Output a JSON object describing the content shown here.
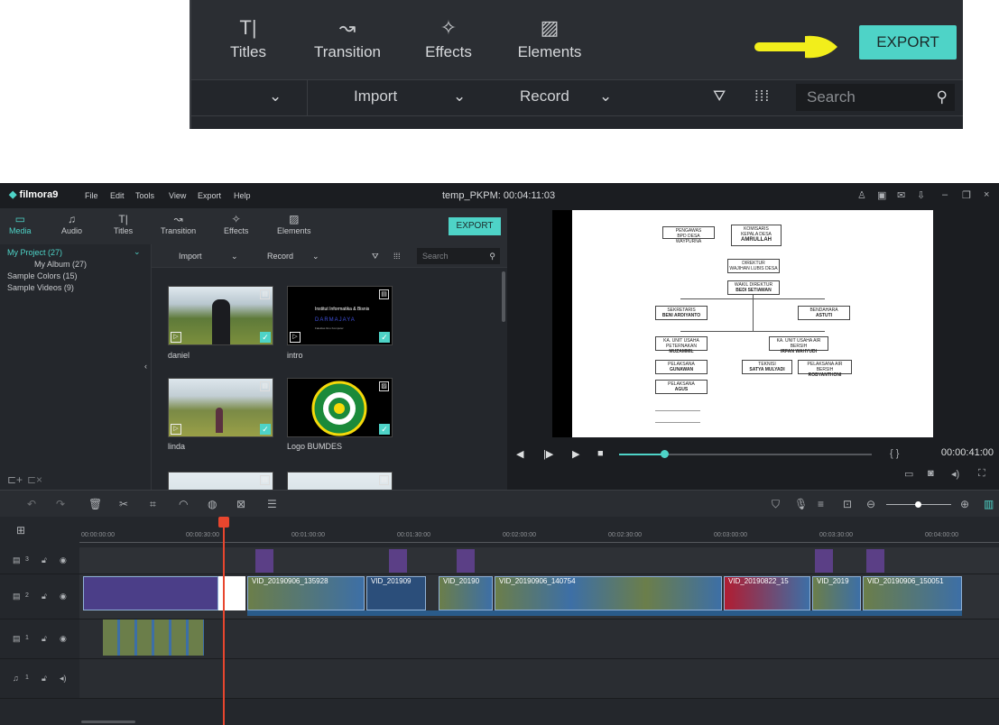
{
  "zoom": {
    "tabs": [
      {
        "label": "Titles",
        "icon": "T|"
      },
      {
        "label": "Transition",
        "icon": "↝"
      },
      {
        "label": "Effects",
        "icon": "✧"
      },
      {
        "label": "Elements",
        "icon": "▨"
      }
    ],
    "export_label": "EXPORT",
    "import_label": "Import",
    "record_label": "Record",
    "search_placeholder": "Search"
  },
  "app": {
    "logo": "filmora9",
    "menu": [
      "File",
      "Edit",
      "Tools",
      "View",
      "Export",
      "Help"
    ],
    "project_title": "temp_PKPM: 00:04:11:03",
    "tabs": [
      {
        "label": "Media",
        "icon": "▭"
      },
      {
        "label": "Audio",
        "icon": "♫"
      },
      {
        "label": "Titles",
        "icon": "T|"
      },
      {
        "label": "Transition",
        "icon": "↝"
      },
      {
        "label": "Effects",
        "icon": "✧"
      },
      {
        "label": "Elements",
        "icon": "▨"
      }
    ],
    "export_label": "EXPORT",
    "library": {
      "items": [
        "My Project (27)",
        "My Album (27)",
        "Sample Colors (15)",
        "Sample Videos (9)"
      ]
    },
    "media_bar": {
      "import": "Import",
      "record": "Record",
      "search_placeholder": "Search"
    },
    "media": [
      {
        "label": "daniel"
      },
      {
        "label": "intro",
        "lines": [
          "Institut Informatika & Bisnis",
          "DARMAJAYA",
          "Fakultas Ilmu Komputer"
        ]
      },
      {
        "label": "linda"
      },
      {
        "label": "Logo BUMDES"
      }
    ],
    "preview": {
      "time": "00:00:41:00",
      "progress": 0.18,
      "org": {
        "pengawas": "PENGAWAS",
        "pengawas_sub": "BPD DESA WAYPURNA",
        "komisaris": "KOMISARIS",
        "komisaris_sub": "KEPALA DESA",
        "komisaris_name": "AMRULLAH",
        "direktur": "DIREKTUR",
        "direktur_sub": "WAJIHAN LUBIS DESA",
        "wakil": "WAKIL DIREKTUR",
        "wakil_name": "BEDI SETIAWAN",
        "sekretaris": "SEKRETARIS",
        "sekretaris_name": "BENI ARDIYANTO",
        "bendahara": "BENDAHARA",
        "bendahara_name": "ASTUTI",
        "kaunit1": "KA. UNIT USAHA PETERNAKAN",
        "kaunit1_name": "MUZAMMIL",
        "kaunit2": "KA. UNIT USAHA AIR BERSIH",
        "kaunit2_name": "IRFAN WAHYUDI",
        "pel1": "PELAKSANA",
        "pel1_name": "GUNAWAN",
        "teknisi": "TEKNISI",
        "teknisi_name": "SATYA MULYADI",
        "pel2": "PELAKSANA AIR BERSIH",
        "pel2_name": "ROBYANTHONI",
        "pel3": "PELAKSANA",
        "pel3_name": "AGUS"
      }
    },
    "ruler": [
      "00:00:00:00",
      "00:00:30:00",
      "00:01:00:00",
      "00:01:30:00",
      "00:02:00:00",
      "00:02:30:00",
      "00:03:00:00",
      "00:03:30:00",
      "00:04:00:00"
    ],
    "tracks": [
      {
        "label": "3"
      },
      {
        "label": "2"
      },
      {
        "label": "1"
      },
      {
        "label": "1"
      }
    ],
    "clips": [
      {
        "label": "VID_20190906_135928"
      },
      {
        "label": "VID_201909"
      },
      {
        "label": "VID_20190"
      },
      {
        "label": "VID_20190906_140754"
      },
      {
        "label": "VID_20190822_15"
      },
      {
        "label": "VID_2019"
      },
      {
        "label": "VID_20190906_150051"
      }
    ]
  }
}
